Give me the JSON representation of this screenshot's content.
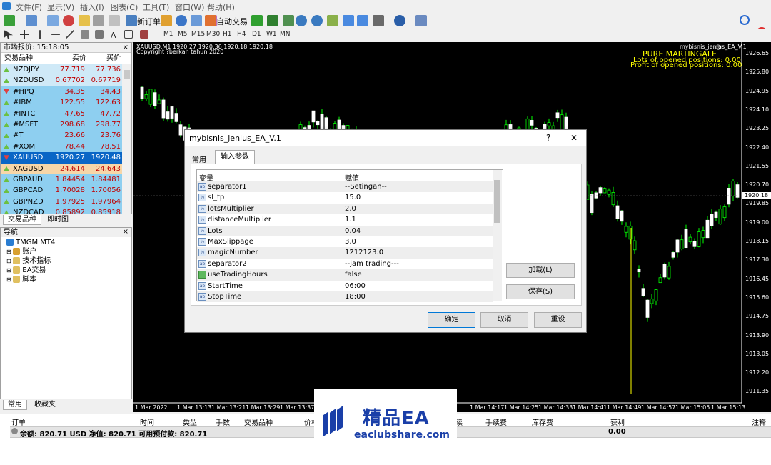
{
  "menu": [
    "文件(F)",
    "显示(V)",
    "插入(I)",
    "图表(C)",
    "工具(T)",
    "窗口(W)",
    "帮助(H)"
  ],
  "toolbar": {
    "new_order": "新订单",
    "auto_trade": "自动交易"
  },
  "timeframes": [
    "M1",
    "M5",
    "M15",
    "M30",
    "H1",
    "H4",
    "D1",
    "W1",
    "MN"
  ],
  "market_watch": {
    "title": "市场报价: 15:18:05",
    "col_symbol": "交易品种",
    "col_bid": "卖价",
    "col_ask": "买价",
    "rows": [
      {
        "symbol": "NZDJPY",
        "bid": "77.719",
        "ask": "77.736",
        "dir": "up"
      },
      {
        "symbol": "NZDUSD",
        "bid": "0.67702",
        "ask": "0.67719",
        "dir": "up"
      },
      {
        "symbol": "#HPQ",
        "bid": "34.35",
        "ask": "34.43",
        "dir": "dn"
      },
      {
        "symbol": "#IBM",
        "bid": "122.55",
        "ask": "122.63",
        "dir": "up"
      },
      {
        "symbol": "#INTC",
        "bid": "47.65",
        "ask": "47.72",
        "dir": "up"
      },
      {
        "symbol": "#MSFT",
        "bid": "298.68",
        "ask": "298.77",
        "dir": "up"
      },
      {
        "symbol": "#T",
        "bid": "23.66",
        "ask": "23.76",
        "dir": "up"
      },
      {
        "symbol": "#XOM",
        "bid": "78.44",
        "ask": "78.51",
        "dir": "up"
      },
      {
        "symbol": "XAUUSD",
        "bid": "1920.27",
        "ask": "1920.48",
        "dir": "dn"
      },
      {
        "symbol": "XAGUSD",
        "bid": "24.614",
        "ask": "24.643",
        "dir": "up"
      },
      {
        "symbol": "GBPAUD",
        "bid": "1.84454",
        "ask": "1.84481",
        "dir": "up"
      },
      {
        "symbol": "GBPCAD",
        "bid": "1.70028",
        "ask": "1.70056",
        "dir": "up"
      },
      {
        "symbol": "GBPNZD",
        "bid": "1.97925",
        "ask": "1.97964",
        "dir": "up"
      },
      {
        "symbol": "NZDCAD",
        "bid": "0.85892",
        "ask": "0.85918",
        "dir": "up"
      }
    ],
    "tabs": [
      "交易品种",
      "即时图"
    ]
  },
  "navigator": {
    "title": "导航",
    "root": "TMGM MT4",
    "items": [
      "账户",
      "技术指标",
      "EA交易",
      "脚本"
    ],
    "tabs": [
      "常用",
      "收藏夹"
    ]
  },
  "chart": {
    "header": "XAUUSD,M1  1920.27 1920.36 1920.18 1920.18",
    "copyright": "Copyright ?berkah tahun 2020",
    "ea_label": "mybisnis_jenius_EA_V.1",
    "info1": "PURE MARTINGALE",
    "info2": "Lots of opened positions: 0.00",
    "info3": "Profit of opened positions: 0.00",
    "price_current": "1920.18",
    "prices": [
      "1926.65",
      "1925.80",
      "1924.95",
      "1924.10",
      "1923.25",
      "1922.40",
      "1921.55",
      "1920.70",
      "1919.85",
      "1919.00",
      "1918.15",
      "1917.30",
      "1916.45",
      "1915.60",
      "1914.75",
      "1913.90",
      "1913.05",
      "1912.20",
      "1911.35"
    ],
    "times": [
      "1 Mar 2022",
      "1 Mar 13:13",
      "1 Mar 13:21",
      "1 Mar 13:29",
      "1 Mar 13:37",
      "1 Mar 14:17",
      "1 Mar 14:25",
      "1 Mar 14:33",
      "1 Mar 14:41",
      "1 Mar 14:49",
      "1 Mar 14:57",
      "1 Mar 15:05",
      "1 Mar 15:13"
    ]
  },
  "dialog": {
    "title": "mybisnis_jenius_EA_V.1",
    "help": "?",
    "close": "✕",
    "tabs": [
      "常用",
      "输入参数"
    ],
    "col_var": "变量",
    "col_val": "赋值",
    "params": [
      {
        "name": "separator1",
        "value": "--Setingan--",
        "type": "ab"
      },
      {
        "name": "sl_tp",
        "value": "15.0",
        "type": "num"
      },
      {
        "name": "lotsMultiplier",
        "value": "2.0",
        "type": "num"
      },
      {
        "name": "distanceMultiplier",
        "value": "1.1",
        "type": "num"
      },
      {
        "name": "Lots",
        "value": "0.04",
        "type": "num"
      },
      {
        "name": "MaxSlippage",
        "value": "3.0",
        "type": "num"
      },
      {
        "name": "magicNumber",
        "value": "1212123.0",
        "type": "num"
      },
      {
        "name": "separator2",
        "value": "--jam trading---",
        "type": "ab"
      },
      {
        "name": "useTradingHours",
        "value": "false",
        "type": "bool"
      },
      {
        "name": "StartTime",
        "value": "06:00",
        "type": "ab"
      },
      {
        "name": "StopTime",
        "value": "18:00",
        "type": "ab"
      }
    ],
    "load": "加载(L)",
    "save": "保存(S)",
    "ok": "确定",
    "cancel": "取消",
    "reset": "重设"
  },
  "terminal": {
    "headers": [
      "订单",
      "时间",
      "类型",
      "手数",
      "交易品种",
      "价格",
      "续",
      "手续费",
      "库存费",
      "获利",
      "注释"
    ],
    "balance": "余额: 820.71 USD  净值: 820.71  可用预付款: 820.71",
    "profit": "0.00"
  },
  "watermark": {
    "brand": "精品EA",
    "site": "eaclubshare.com"
  },
  "notification_count": "1"
}
